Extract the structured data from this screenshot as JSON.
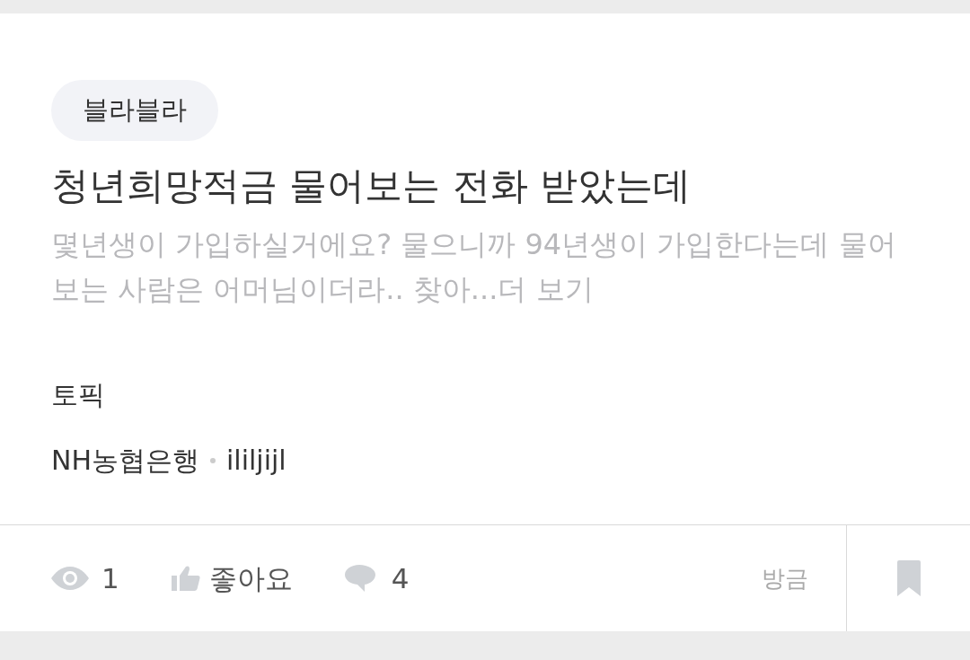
{
  "tag": "블라블라",
  "title": "청년희망적금 물어보는 전화 받았는데",
  "preview": "몇년생이 가입하실거에요? 물으니까 94년생이 가입한다는데 물어보는 사람은 어머님이더라.. 찾아...더 보기",
  "topic_label": "토픽",
  "company": "NH농협은행",
  "author": "ililjijl",
  "stats": [
    {
      "kind": "views",
      "value": "1"
    },
    {
      "kind": "likes",
      "value": "좋아요"
    },
    {
      "kind": "comments",
      "value": "4"
    }
  ],
  "time": "방금",
  "bookmarked": false
}
